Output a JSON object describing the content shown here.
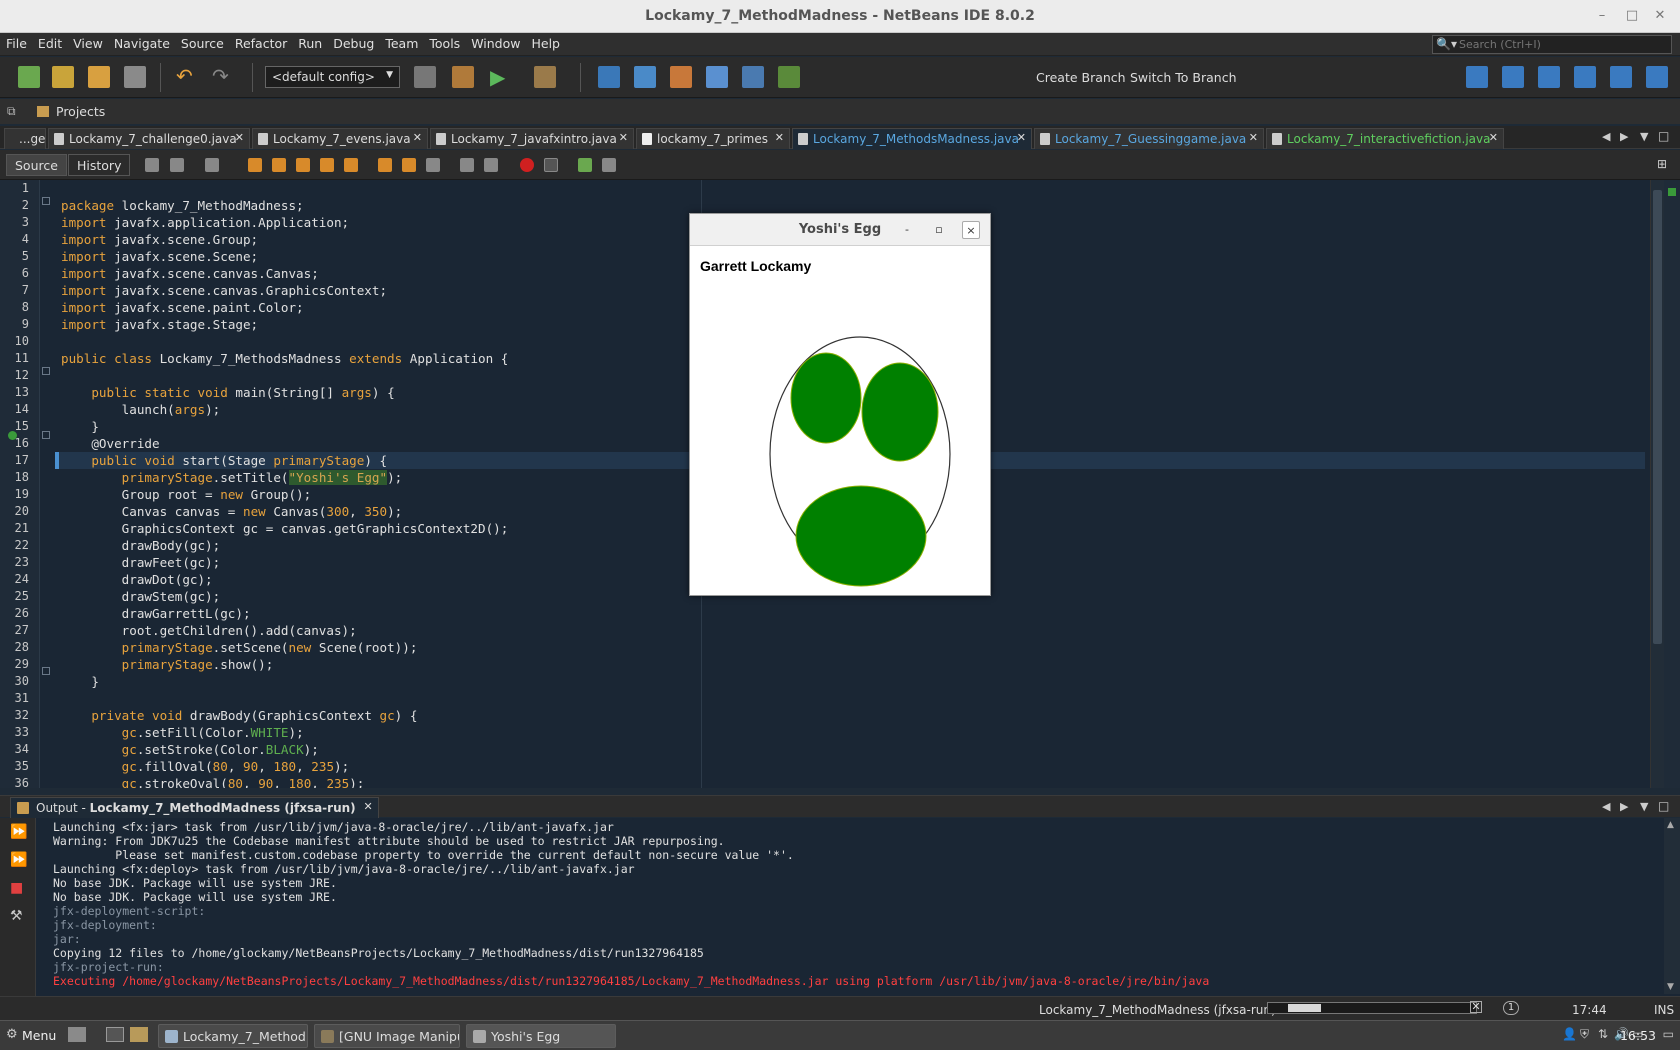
{
  "window": {
    "title": "Lockamy_7_MethodMadness - NetBeans IDE 8.0.2"
  },
  "menu": {
    "items": [
      "File",
      "Edit",
      "View",
      "Navigate",
      "Source",
      "Refactor",
      "Run",
      "Debug",
      "Team",
      "Tools",
      "Window",
      "Help"
    ]
  },
  "search": {
    "placeholder": "Search (Ctrl+I)"
  },
  "toolbar": {
    "config": "<default config>",
    "create_branch": "Create Branch",
    "switch_branch": "Switch To Branch"
  },
  "projects": {
    "label": "Projects"
  },
  "tabs": [
    {
      "label": "...ge",
      "active": false
    },
    {
      "label": "Lockamy_7_challenge0.java",
      "active": false
    },
    {
      "label": "Lockamy_7_evens.java",
      "active": false
    },
    {
      "label": "Lockamy_7_javafxintro.java",
      "active": false
    },
    {
      "label": "lockamy_7_primes",
      "active": false
    },
    {
      "label": "Lockamy_7_MethodsMadness.java",
      "active": true
    },
    {
      "label": "Lockamy_7_Guessinggame.java",
      "active": false
    },
    {
      "label": "Lockamy_7_interactivefiction.java",
      "active": false
    }
  ],
  "editor": {
    "source_label": "Source",
    "history_label": "History",
    "line_numbers": [
      "1",
      "2",
      "3",
      "4",
      "5",
      "6",
      "7",
      "8",
      "9",
      "10",
      "11",
      "12",
      "13",
      "14",
      "15",
      "16",
      "17",
      "18",
      "19",
      "20",
      "21",
      "22",
      "23",
      "24",
      "25",
      "26",
      "27",
      "28",
      "29",
      "30",
      "31",
      "32",
      "33",
      "34",
      "35",
      "36"
    ],
    "current_line": 17
  },
  "fx_window": {
    "title": "Yoshi's Egg",
    "min": "-",
    "max": "▫",
    "close": "×",
    "text": "Garrett Lockamy",
    "colors": {
      "fill": "#008000",
      "stroke": "#333333"
    }
  },
  "output": {
    "tab_prefix": "Output - ",
    "tab_label": "Lockamy_7_MethodMadness (jfxsa-run)",
    "lines": [
      {
        "text": "Launching <fx:jar> task from /usr/lib/jvm/java-8-oracle/jre/../lib/ant-javafx.jar",
        "style": "o-norm"
      },
      {
        "text": "Warning: From JDK7u25 the Codebase manifest attribute should be used to restrict JAR repurposing.",
        "style": "o-norm"
      },
      {
        "text": "         Please set manifest.custom.codebase property to override the current default non-secure value '*'.",
        "style": "o-norm"
      },
      {
        "text": "Launching <fx:deploy> task from /usr/lib/jvm/java-8-oracle/jre/../lib/ant-javafx.jar",
        "style": "o-norm"
      },
      {
        "text": "No base JDK. Package will use system JRE.",
        "style": "o-norm"
      },
      {
        "text": "No base JDK. Package will use system JRE.",
        "style": "o-norm"
      },
      {
        "text": "jfx-deployment-script:",
        "style": "o-dim"
      },
      {
        "text": "jfx-deployment:",
        "style": "o-dim"
      },
      {
        "text": "jar:",
        "style": "o-dim"
      },
      {
        "text": "Copying 12 files to /home/glockamy/NetBeansProjects/Lockamy_7_MethodMadness/dist/run1327964185",
        "style": "o-norm"
      },
      {
        "text": "jfx-project-run:",
        "style": "o-dim"
      },
      {
        "text": "Executing /home/glockamy/NetBeansProjects/Lockamy_7_MethodMadness/dist/run1327964185/Lockamy_7_MethodMadness.jar using platform /usr/lib/jvm/java-8-oracle/jre/bin/java",
        "style": "o-err"
      }
    ]
  },
  "status": {
    "task": "Lockamy_7_MethodMadness (jfxsa-run)",
    "progress": 0.16,
    "notifications": "1",
    "position": "17:44",
    "mode": "INS"
  },
  "taskbar": {
    "menu": "Menu",
    "windows": [
      "Lockamy_7_Method...",
      "[GNU Image Manipu...",
      "Yoshi's Egg"
    ],
    "time": "16:53"
  }
}
